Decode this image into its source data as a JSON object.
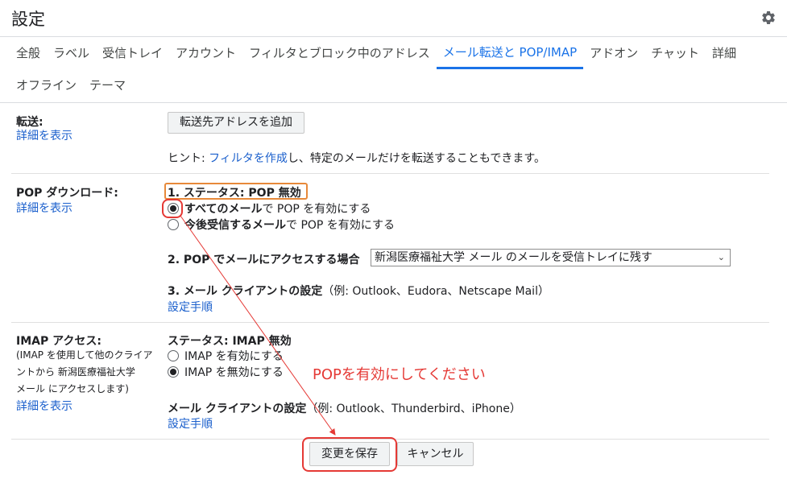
{
  "header": {
    "title": "設定",
    "gear_icon": "gear-icon"
  },
  "tabs": [
    {
      "label": "全般"
    },
    {
      "label": "ラベル"
    },
    {
      "label": "受信トレイ"
    },
    {
      "label": "アカウント"
    },
    {
      "label": "フィルタとブロック中のアドレス"
    },
    {
      "label": "メール転送と POP/IMAP",
      "active": true
    },
    {
      "label": "アドオン"
    },
    {
      "label": "チャット"
    },
    {
      "label": "詳細"
    },
    {
      "label": "オフライン"
    },
    {
      "label": "テーマ"
    }
  ],
  "forwarding": {
    "label": "転送:",
    "details_link": "詳細を表示",
    "add_button": "転送先アドレスを追加",
    "hint_prefix": "ヒント: ",
    "hint_link": "フィルタを作成",
    "hint_suffix": "し、特定のメールだけを転送することもできます。"
  },
  "pop": {
    "label": "POP ダウンロード:",
    "details_link": "詳細を表示",
    "status": "1. ステータス: POP 無効",
    "option_all_bold": "すべてのメール",
    "option_all_rest": "で POP を有効にする",
    "option_future_bold": "今後受信するメール",
    "option_future_rest": "で POP を有効にする",
    "access_label": "2. POP でメールにアクセスする場合",
    "access_select": "新潟医療福祉大学 メール のメールを受信トレイに残す",
    "client_label": "3. メール クライアントの設定",
    "client_example": "（例: Outlook、Eudora、Netscape Mail）",
    "client_link": "設定手順"
  },
  "imap": {
    "label": "IMAP アクセス:",
    "note_line1": "(IMAP を使用して他のクライア",
    "note_line2": "ントから 新潟医療福祉大学",
    "note_line3": "メール にアクセスします)",
    "details_link": "詳細を表示",
    "status": "ステータス: IMAP 無効",
    "option_enable": "IMAP を有効にする",
    "option_disable": "IMAP を無効にする",
    "client_label": "メール クライアントの設定",
    "client_example": "（例: Outlook、Thunderbird、iPhone）",
    "client_link": "設定手順"
  },
  "actions": {
    "save": "変更を保存",
    "cancel": "キャンセル"
  },
  "annotation": {
    "text": "POPを有効にしてください",
    "color": "#e53935"
  }
}
